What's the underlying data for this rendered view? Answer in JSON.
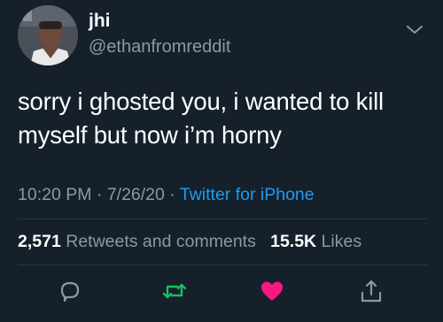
{
  "user": {
    "display_name": "jhi",
    "handle": "@ethanfromreddit"
  },
  "tweet": {
    "lines": [
      "sorry i ghosted you, i wanted to kill",
      "myself but now i’m horny"
    ]
  },
  "meta": {
    "time": "10:20 PM",
    "separator": "·",
    "date": "7/26/20",
    "source": "Twitter for iPhone"
  },
  "stats": {
    "retweets_count": "2,571",
    "retweets_label": "Retweets and comments",
    "likes_count": "15.5K",
    "likes_label": "Likes"
  },
  "icons": {
    "more": "chevron-down-icon",
    "reply": "comment-icon",
    "retweet": "retweet-icon",
    "like": "heart-icon",
    "share": "share-icon"
  },
  "colors": {
    "background": "#15202b",
    "secondary_text": "#8b98a5",
    "link": "#1d9bf0",
    "retweet": "#17bf63",
    "like": "#f91880"
  }
}
